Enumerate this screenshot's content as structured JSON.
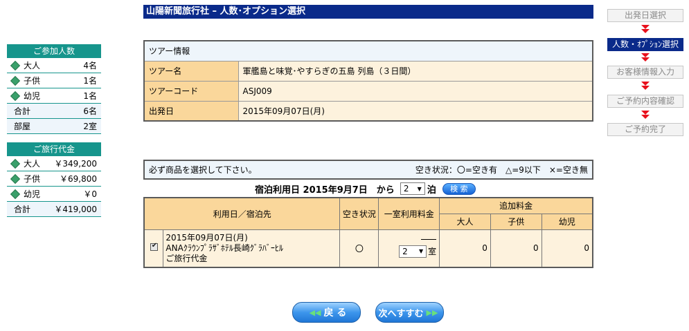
{
  "title": "山陽新聞旅行社 – 人数･オプション選択",
  "participants": {
    "header": "ご参加人数",
    "rows": [
      {
        "label": "大人",
        "value": "4名"
      },
      {
        "label": "子供",
        "value": "1名"
      },
      {
        "label": "幼児",
        "value": "1名"
      }
    ],
    "total_label": "合計",
    "total_value": "6名",
    "rooms_label": "部屋",
    "rooms_value": "2室"
  },
  "cost": {
    "header": "ご旅行代金",
    "rows": [
      {
        "label": "大人",
        "value": "￥349,200"
      },
      {
        "label": "子供",
        "value": "￥69,800"
      },
      {
        "label": "幼児",
        "value": "￥0"
      }
    ],
    "total_label": "合計",
    "total_value": "￥419,000"
  },
  "tour": {
    "header": "ツアー情報",
    "name_label": "ツアー名",
    "name_value": "軍艦島と味覚･やすらぎの五島 列島（３日間）",
    "code_label": "ツアーコード",
    "code_value": "ASJ009",
    "date_label": "出発日",
    "date_value": "2015年09月07日(月)"
  },
  "selection": {
    "notice": "必ず商品を選択して下さい。",
    "status_legend": "空き状況：〇=空き有　△=9以下　×=空き無",
    "stay_date_text": "宿泊利用日 2015年9月7日　から",
    "nights_value": "2",
    "nights_suffix": "泊",
    "search_label": "検 索"
  },
  "plans_table": {
    "col_date_hotel": "利用日／宿泊先",
    "col_availability": "空き状況",
    "col_room_rate": "一室利用料金",
    "col_additional": "追加料金",
    "col_adult": "大人",
    "col_child": "子供",
    "col_infant": "幼児",
    "rows": [
      {
        "date": "2015年09月07日(月)",
        "hotel": "ANAｸﾗｳﾝﾌﾟﾗｻﾞﾎﾃﾙ長崎ｸﾞﾗﾊﾞｰﾋﾙ",
        "note": "ご旅行代金",
        "availability": "〇",
        "rooms_value": "2",
        "rooms_suffix": "室",
        "adult": "0",
        "child": "0",
        "infant": "0"
      }
    ]
  },
  "buttons": {
    "back": "戻 る",
    "next": "次へすすむ"
  },
  "steps": [
    {
      "label": "出発日選択"
    },
    {
      "label": "人数・ｵﾌﾟｼｮﾝ選択"
    },
    {
      "label": "お客様情報入力"
    },
    {
      "label": "ご予約内容確認"
    },
    {
      "label": "ご予約完了"
    }
  ],
  "colors": {
    "title_bar": "#0a2a8a",
    "sidebar_header": "#16958c",
    "table_key": "#fad79b",
    "table_value": "#fdf2dd",
    "step_arrow": "#e8101c"
  }
}
